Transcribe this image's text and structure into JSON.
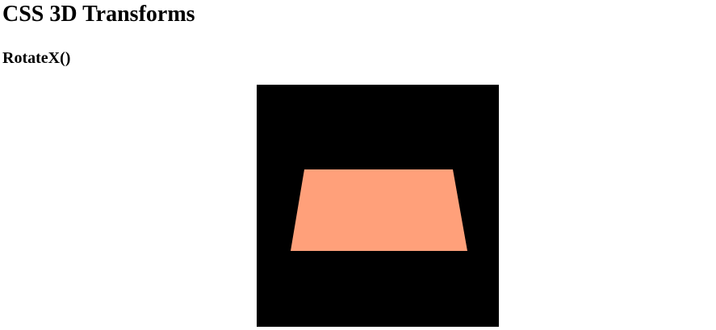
{
  "page": {
    "title": "CSS 3D Transforms",
    "section_title": "RotateX()"
  },
  "demo": {
    "stage_color": "#000000",
    "box_color": "#ffa07a"
  }
}
